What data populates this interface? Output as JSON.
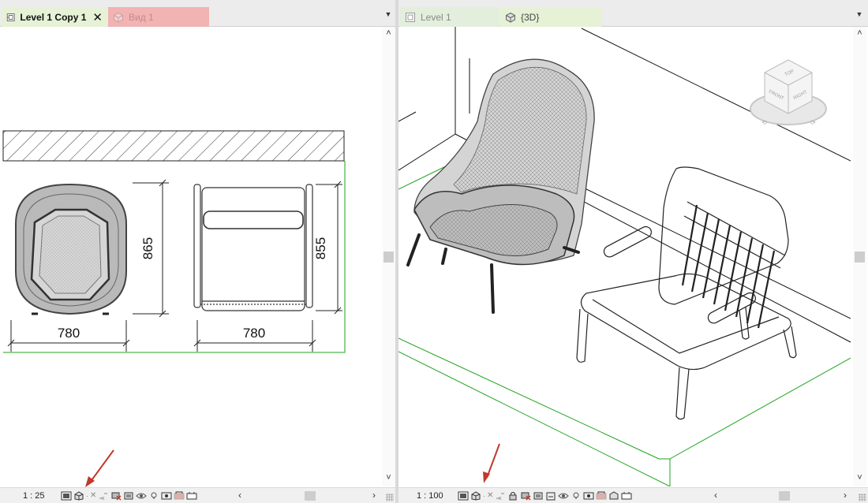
{
  "left_view": {
    "tabs": [
      {
        "label": "Level 1 Copy 1",
        "icon": "floor-plan-icon",
        "state": "active",
        "close": "✕"
      },
      {
        "label": "Вид 1",
        "icon": "3d-view-icon",
        "state": "inactive"
      }
    ],
    "dimensions": {
      "width_left": "780",
      "width_right": "780",
      "depth_left": "865",
      "depth_right": "855"
    },
    "scale": "1 : 25"
  },
  "right_view": {
    "tabs": [
      {
        "label": "Level 1",
        "icon": "floor-plan-icon",
        "state": "inactive"
      },
      {
        "label": "{3D}",
        "icon": "3d-view-icon",
        "state": "active"
      }
    ],
    "viewcube": {
      "top": "TOP",
      "front": "FRONT",
      "right": "RIGHT"
    },
    "scale": "1 : 100"
  },
  "colors": {
    "active_tab": "#e6f1d6",
    "pink_tab": "#f2b3b3",
    "crop_green": "#1fa31f",
    "annotation_red": "#c0392b"
  }
}
